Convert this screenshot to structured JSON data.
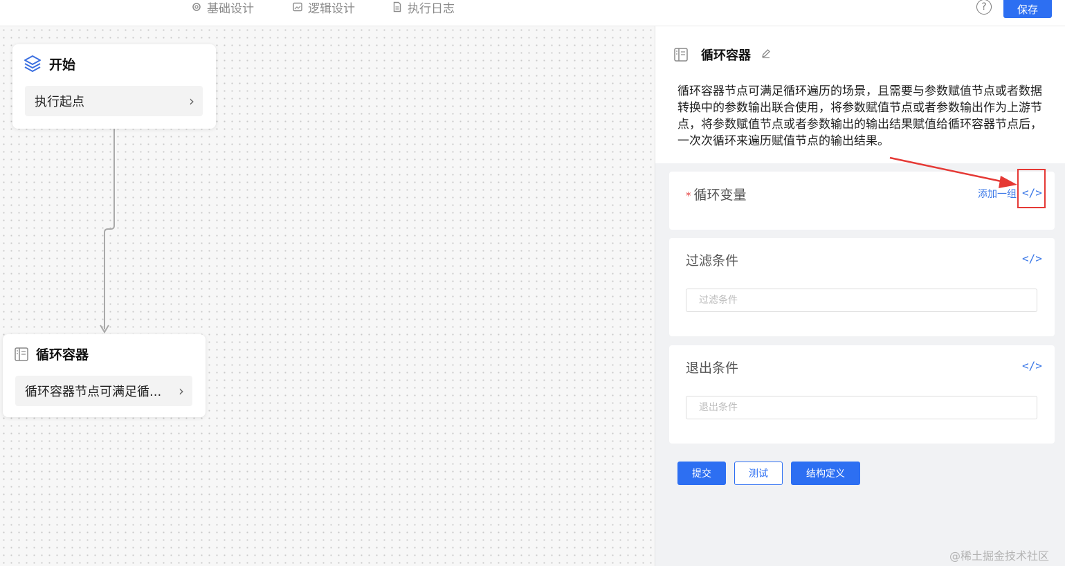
{
  "tabs": [
    {
      "label": "基础设计",
      "icon": "gear-icon"
    },
    {
      "label": "逻辑设计",
      "icon": "image-icon"
    },
    {
      "label": "执行日志",
      "icon": "document-icon"
    }
  ],
  "header": {
    "help": "?",
    "save_label": "保存"
  },
  "canvas": {
    "start_node": {
      "title": "开始",
      "icon": "layers-icon",
      "desc": "执行起点"
    },
    "loop_node": {
      "title": "循环容器",
      "icon": "container-icon",
      "desc": "循环容器节点可满足循..."
    }
  },
  "panel": {
    "title": "循环容器",
    "description": "循环容器节点可满足循环遍历的场景，且需要与参数赋值节点或者数据转换中的参数输出联合使用，将参数赋值节点或者参数输出作为上游节点，将参数赋值节点或者参数输出的输出结果赋值给循环容器节点后，一次次循环来遍历赋值节点的输出结果。",
    "loop_var": {
      "required_mark": "*",
      "label": "循环变量",
      "add_link": "添加一组",
      "code": "</>"
    },
    "filter": {
      "label": "过滤条件",
      "placeholder": "过滤条件",
      "code": "</>"
    },
    "exit": {
      "label": "退出条件",
      "placeholder": "退出条件",
      "code": "</>"
    },
    "buttons": {
      "submit": "提交",
      "test": "测试",
      "schema": "结构定义"
    }
  },
  "watermark": "@稀土掘金技术社区",
  "colors": {
    "primary": "#2d6ff2",
    "highlight": "#e53935"
  }
}
